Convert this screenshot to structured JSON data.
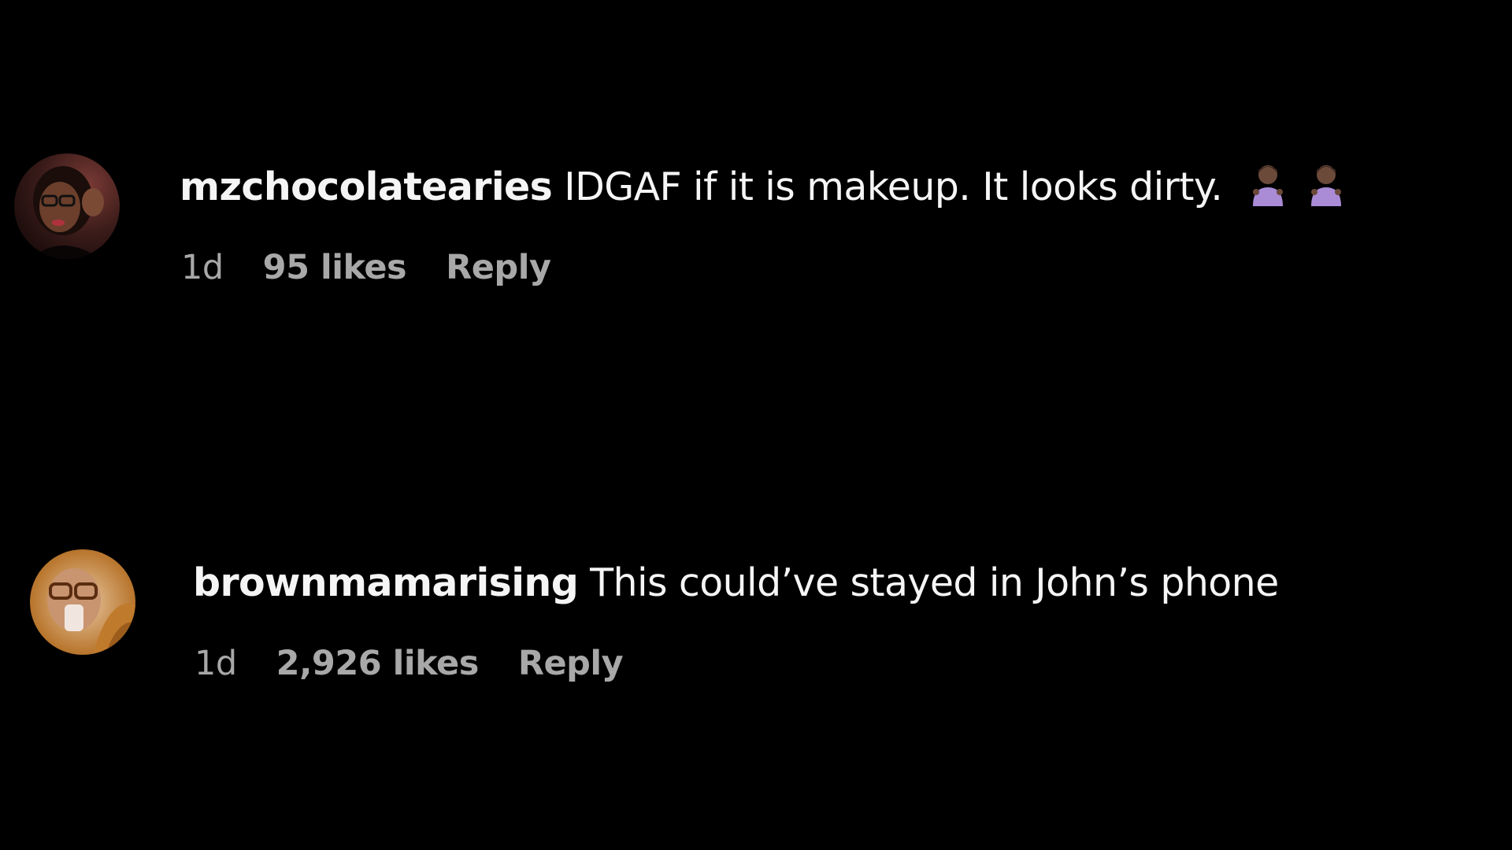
{
  "comments": [
    {
      "username": "mzchocolatearies",
      "text": "IDGAF if it is makeup. It looks dirty.",
      "emojis": [
        "woman-shrugging-emoji",
        "woman-shrugging-emoji"
      ],
      "time": "1d",
      "likes": "95 likes",
      "reply_label": "Reply"
    },
    {
      "username": "brownmamarising",
      "text": "This could’ve stayed in John’s phone",
      "time": "1d",
      "likes": "2,926 likes",
      "reply_label": "Reply"
    }
  ],
  "colors": {
    "background": "#000000",
    "primary_text": "#f5f5f5",
    "secondary_text": "#a8a8a8"
  }
}
